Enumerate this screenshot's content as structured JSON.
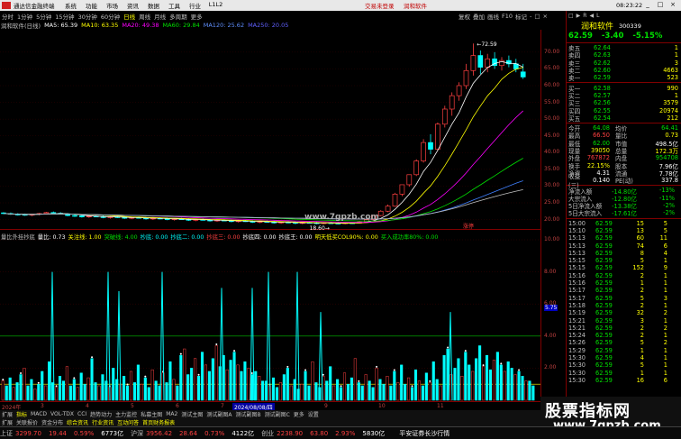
{
  "titlebar": {
    "app_title": "通达信金融终端",
    "menu": [
      "系统",
      "功能",
      "市场",
      "资讯",
      "数据",
      "工具",
      "行业",
      "L1L2"
    ],
    "warning": "交易未登录",
    "company": "润和软件",
    "clock": "08:23:22",
    "min": "_",
    "max": "□",
    "close": "×"
  },
  "periodbar": {
    "items": [
      "分时",
      "1分钟",
      "5分钟",
      "15分钟",
      "30分钟",
      "60分钟",
      "日线",
      "周线",
      "月线",
      "多周期",
      "更多"
    ],
    "active": "日线",
    "right_tools": [
      "复权",
      "叠加",
      "画线",
      "F10",
      "标记",
      "-",
      "□",
      "×"
    ]
  },
  "main_header": {
    "title": "润和软件(日线)",
    "ma5": "MA5: 65.39",
    "ma10": "MA10: 63.35",
    "ma20": "MA20: 49.38",
    "ma60": "MA60: 29.84",
    "ma120": "MA120: 25.62",
    "ma250": "MA250: 20.05"
  },
  "sub_header": {
    "items": [
      {
        "text": "量比外挂抄底",
        "color": "#c0c0c0"
      },
      {
        "text": "量比: 0.73",
        "color": "#ffffff"
      },
      {
        "text": "关注线: 1.00",
        "color": "#ffff00"
      },
      {
        "text": "突破线: 4.00",
        "color": "#00e000"
      },
      {
        "text": "抄底: 0.00",
        "color": "#00ffff"
      },
      {
        "text": "抄底二: 0.00",
        "color": "#00ffff"
      },
      {
        "text": "抄底三: 0.00",
        "color": "#ff4040"
      },
      {
        "text": "抄底四: 0.00",
        "color": "#ffffff"
      },
      {
        "text": "抄底王: 0.00",
        "color": "#ffffff"
      },
      {
        "text": "明天低买COL90%: 0.00",
        "color": "#ffff00"
      },
      {
        "text": "买入成功率80%: 0.00",
        "color": "#00e000"
      }
    ]
  },
  "y_axis": {
    "main": [
      "70.00",
      "65.00",
      "60.00",
      "55.00",
      "50.00",
      "45.00",
      "40.00",
      "35.00",
      "30.00",
      "25.00",
      "20.00"
    ],
    "sub": [
      "10.00",
      "8.00",
      "6.00",
      "5.75",
      "4.00",
      "2.00",
      "0.00"
    ],
    "current_marker": "5.75"
  },
  "chart_labels": {
    "high_label": "72.59",
    "low_label": "18.60",
    "watermark": "www.7gpzb.com",
    "zt_tag": "涨停"
  },
  "time_axis": [
    "2024年",
    "3",
    "4",
    "5",
    "6",
    "7",
    "8",
    "9",
    "10",
    "11"
  ],
  "time_axis_highlight": "2024/08/08/四",
  "bottom_tabs": [
    "扩展",
    "指标",
    "MACD",
    "VOL-TDX",
    "CCI",
    "趋势动力",
    "主力监控",
    "私募主图",
    "MA2",
    "测试主图",
    "测试副图A",
    "测试副图B",
    "测试副图C",
    "更多",
    "设置"
  ],
  "bottom_tabs2": [
    "扩展",
    "关联报价",
    "资金分布",
    "综合资讯",
    "行业资讯",
    "互动问答",
    "首页财务报表"
  ],
  "status": {
    "items": [
      {
        "label": "上证",
        "value": "3299.70",
        "chg": "19.44",
        "pct": "0.59%",
        "amt": "6773亿",
        "dir": "up"
      },
      {
        "label": "沪深",
        "value": "3956.42",
        "chg": "28.64",
        "pct": "0.73%",
        "amt": "4122亿",
        "dir": "up"
      },
      {
        "label": "创业",
        "value": "2238.90",
        "chg": "63.80",
        "pct": "2.93%",
        "amt": "5830亿",
        "dir": "up"
      }
    ],
    "right_text": "平安证券长沙行情"
  },
  "quote": {
    "top_tabs": [
      "□",
      "▶",
      "R",
      "◀",
      "L"
    ],
    "name": "润和软件",
    "code": "300339",
    "price": "62.59",
    "change": "-3.40",
    "pct": "-5.15%",
    "asks": [
      {
        "label": "卖五",
        "price": "62.64",
        "vol": "1"
      },
      {
        "label": "卖四",
        "price": "62.63",
        "vol": "1"
      },
      {
        "label": "卖三",
        "price": "62.62",
        "vol": "3"
      },
      {
        "label": "卖二",
        "price": "62.60",
        "vol": "4663"
      },
      {
        "label": "卖一",
        "price": "62.59",
        "vol": "523"
      }
    ],
    "bids": [
      {
        "label": "买一",
        "price": "62.58",
        "vol": "990"
      },
      {
        "label": "买二",
        "price": "62.57",
        "vol": "1"
      },
      {
        "label": "买三",
        "price": "62.56",
        "vol": "3579"
      },
      {
        "label": "买四",
        "price": "62.55",
        "vol": "20974"
      },
      {
        "label": "买五",
        "price": "62.54",
        "vol": "212"
      }
    ],
    "stats": [
      {
        "k1": "今开",
        "v1": "64.08",
        "c1": "green",
        "k2": "均价",
        "v2": "64.41",
        "c2": "green"
      },
      {
        "k1": "最高",
        "v1": "66.50",
        "c1": "red",
        "k2": "量比",
        "v2": "0.73",
        "c2": "yellow"
      },
      {
        "k1": "最低",
        "v1": "62.00",
        "c1": "green",
        "k2": "市值",
        "v2": "498.5亿",
        "c2": "white"
      },
      {
        "k1": "现量",
        "v1": "39050",
        "c1": "yellow",
        "k2": "总量",
        "v2": "172.3万",
        "c2": "yellow"
      },
      {
        "k1": "外盘",
        "v1": "767872",
        "c1": "red",
        "k2": "内盘",
        "v2": "954708",
        "c2": "green"
      },
      {
        "k1": "换手",
        "v1": "22.15%",
        "c1": "yellow",
        "k2": "股本",
        "v2": "7.96亿",
        "c2": "white"
      },
      {
        "k1": "净资",
        "v1": "4.31",
        "c1": "white",
        "k2": "流通",
        "v2": "7.78亿",
        "c2": "white"
      },
      {
        "k1": "收益(三)",
        "v1": "0.140",
        "c1": "white",
        "k2": "PE(动)",
        "v2": "337.8",
        "c2": "white"
      }
    ],
    "flows": [
      {
        "k": "净流入额",
        "v": "-14.80亿",
        "p": "-13%"
      },
      {
        "k": "大宗流入",
        "v": "-12.80亿",
        "p": "-11%"
      },
      {
        "k": "5日净流入额",
        "v": "-13.38亿",
        "p": "-2%"
      },
      {
        "k": "5日大宗流入",
        "v": "-17.61亿",
        "p": "-2%"
      }
    ],
    "ticks": [
      {
        "t": "15:00",
        "p": "62.59",
        "v": "15",
        "f": "5"
      },
      {
        "t": "15:10",
        "p": "62.59",
        "v": "13",
        "f": "5"
      },
      {
        "t": "15:13",
        "p": "62.59",
        "v": "60",
        "f": "11"
      },
      {
        "t": "15:13",
        "p": "62.59",
        "v": "74",
        "f": "6"
      },
      {
        "t": "15:13",
        "p": "62.59",
        "v": "8",
        "f": "4"
      },
      {
        "t": "15:15",
        "p": "62.59",
        "v": "5",
        "f": "1"
      },
      {
        "t": "15:15",
        "p": "62.59",
        "v": "152",
        "f": "9"
      },
      {
        "t": "15:16",
        "p": "62.59",
        "v": "2",
        "f": "1"
      },
      {
        "t": "15:16",
        "p": "62.59",
        "v": "1",
        "f": "1"
      },
      {
        "t": "15:17",
        "p": "62.59",
        "v": "2",
        "f": "1"
      },
      {
        "t": "15:17",
        "p": "62.59",
        "v": "5",
        "f": "3"
      },
      {
        "t": "15:18",
        "p": "62.59",
        "v": "2",
        "f": "1"
      },
      {
        "t": "15:19",
        "p": "62.59",
        "v": "32",
        "f": "2"
      },
      {
        "t": "15:21",
        "p": "62.59",
        "v": "3",
        "f": "1"
      },
      {
        "t": "15:21",
        "p": "62.59",
        "v": "2",
        "f": "2"
      },
      {
        "t": "15:24",
        "p": "62.59",
        "v": "2",
        "f": "1"
      },
      {
        "t": "15:26",
        "p": "62.59",
        "v": "5",
        "f": "2"
      },
      {
        "t": "15:29",
        "p": "62.59",
        "v": "1",
        "f": "1"
      },
      {
        "t": "15:30",
        "p": "62.59",
        "v": "4",
        "f": "1"
      },
      {
        "t": "15:30",
        "p": "62.59",
        "v": "5",
        "f": "1"
      },
      {
        "t": "15:30",
        "p": "62.59",
        "v": "1",
        "f": "1"
      },
      {
        "t": "15:30",
        "p": "62.59",
        "v": "16",
        "f": "6"
      }
    ]
  },
  "ad": {
    "line1": "股票指标网",
    "line2": "www.7gpzb.com"
  },
  "chart_data": {
    "type": "candlestick+histogram",
    "ylim_main": [
      18,
      74
    ],
    "ylim_sub": [
      0,
      10
    ],
    "candles": [
      [
        22.0,
        22.2,
        21.6,
        21.8
      ],
      [
        21.8,
        22.1,
        21.4,
        21.6
      ],
      [
        21.6,
        21.9,
        21.2,
        21.5
      ],
      [
        21.5,
        21.8,
        21.1,
        21.3
      ],
      [
        21.3,
        21.7,
        21.0,
        21.6
      ],
      [
        21.6,
        22.0,
        21.3,
        21.8
      ],
      [
        21.8,
        22.3,
        21.6,
        22.1
      ],
      [
        22.1,
        22.4,
        21.7,
        21.9
      ],
      [
        21.9,
        22.2,
        21.5,
        21.7
      ],
      [
        21.7,
        21.9,
        21.0,
        21.2
      ],
      [
        21.2,
        21.5,
        20.8,
        21.1
      ],
      [
        21.1,
        21.4,
        20.6,
        20.8
      ],
      [
        20.8,
        21.2,
        20.5,
        21.0
      ],
      [
        21.0,
        21.3,
        20.7,
        20.9
      ],
      [
        20.9,
        21.2,
        20.4,
        20.6
      ],
      [
        20.6,
        21.0,
        20.3,
        20.8
      ],
      [
        20.8,
        21.1,
        20.5,
        20.7
      ],
      [
        20.7,
        21.0,
        20.2,
        20.4
      ],
      [
        20.4,
        20.8,
        20.1,
        20.6
      ],
      [
        20.6,
        20.9,
        20.3,
        20.5
      ],
      [
        20.5,
        20.8,
        20.0,
        20.2
      ],
      [
        20.2,
        20.6,
        19.9,
        20.4
      ],
      [
        20.4,
        20.7,
        20.1,
        20.3
      ],
      [
        20.3,
        20.6,
        19.8,
        20.0
      ],
      [
        20.0,
        20.4,
        19.7,
        20.2
      ],
      [
        20.2,
        20.5,
        19.9,
        20.1
      ],
      [
        20.1,
        20.4,
        19.6,
        19.8
      ],
      [
        19.8,
        20.2,
        19.5,
        20.0
      ],
      [
        20.0,
        20.3,
        19.7,
        19.9
      ],
      [
        19.9,
        20.2,
        19.4,
        19.6
      ],
      [
        19.6,
        20.0,
        19.3,
        19.8
      ],
      [
        19.8,
        20.1,
        19.5,
        19.7
      ],
      [
        19.7,
        20.0,
        19.2,
        19.4
      ],
      [
        19.4,
        19.8,
        19.1,
        19.6
      ],
      [
        19.6,
        19.9,
        19.3,
        19.5
      ],
      [
        19.5,
        19.8,
        19.0,
        19.2
      ],
      [
        19.2,
        19.6,
        18.9,
        19.4
      ],
      [
        19.4,
        19.7,
        19.1,
        19.3
      ],
      [
        19.3,
        19.6,
        18.8,
        19.0
      ],
      [
        19.0,
        19.4,
        18.7,
        19.2
      ],
      [
        19.2,
        19.5,
        18.9,
        19.1
      ],
      [
        19.1,
        19.4,
        18.6,
        18.9
      ],
      [
        18.9,
        19.3,
        18.6,
        19.1
      ],
      [
        19.1,
        19.4,
        18.8,
        19.0
      ],
      [
        19.0,
        19.3,
        18.6,
        18.8
      ],
      [
        18.8,
        19.2,
        18.6,
        19.0
      ],
      [
        19.0,
        19.3,
        18.7,
        18.9
      ],
      [
        18.9,
        19.2,
        18.6,
        18.8
      ],
      [
        18.8,
        19.1,
        18.6,
        19.0
      ],
      [
        19.0,
        19.2,
        18.7,
        18.9
      ],
      [
        18.9,
        19.5,
        18.8,
        19.3
      ],
      [
        19.3,
        20.2,
        19.1,
        20.0
      ],
      [
        20.0,
        21.5,
        19.8,
        21.2
      ],
      [
        21.2,
        22.8,
        21.0,
        22.5
      ],
      [
        22.5,
        24.5,
        22.2,
        24.0
      ],
      [
        24.0,
        28.0,
        23.8,
        27.6
      ],
      [
        27.6,
        30.4,
        27.0,
        30.4
      ],
      [
        30.4,
        33.4,
        29.8,
        33.4
      ],
      [
        33.4,
        38.0,
        33.0,
        37.5
      ],
      [
        37.5,
        44.0,
        37.0,
        43.0
      ],
      [
        43.0,
        45.5,
        39.5,
        41.0
      ],
      [
        41.0,
        49.0,
        40.5,
        48.5
      ],
      [
        48.5,
        54.0,
        47.5,
        53.0
      ],
      [
        53.0,
        58.0,
        51.0,
        57.0
      ],
      [
        57.0,
        61.0,
        55.5,
        60.0
      ],
      [
        60.0,
        66.5,
        59.0,
        64.5
      ],
      [
        64.5,
        72.6,
        63.0,
        69.0
      ],
      [
        69.0,
        70.5,
        63.5,
        65.5
      ],
      [
        65.5,
        69.5,
        64.0,
        68.0
      ],
      [
        68.0,
        70.0,
        65.0,
        66.0
      ],
      [
        66.0,
        68.5,
        64.5,
        67.5
      ],
      [
        67.5,
        69.0,
        65.5,
        66.5
      ],
      [
        66.5,
        68.0,
        64.0,
        65.0
      ],
      [
        64.1,
        66.5,
        62.0,
        62.6
      ]
    ],
    "volume": [
      1.2,
      0.9,
      1.4,
      0.8,
      1.1,
      1.6,
      2.0,
      0.9,
      1.3,
      0.7,
      1.0,
      1.8,
      0.9,
      2.4,
      1.1,
      0.8,
      1.5,
      1.2,
      2.1,
      0.9,
      1.3,
      0.8,
      1.7,
      1.0,
      1.4,
      2.6,
      1.1,
      0.9,
      1.6,
      1.2,
      0.8,
      2.0,
      1.3,
      1.0,
      1.5,
      0.9,
      1.8,
      1.1,
      2.2,
      1.0,
      1.4,
      0.8,
      1.9,
      1.2,
      0.9,
      1.7,
      1.1,
      2.4,
      1.3,
      0.9,
      2.8,
      3.2,
      1.6,
      2.0,
      2.6,
      1.5,
      3.0,
      2.2,
      1.8,
      2.6,
      3.4,
      2.1,
      2.8,
      1.9,
      2.5,
      3.0,
      2.2,
      1.8,
      2.4,
      2.0,
      1.6,
      1.8,
      1.5,
      1.2
    ],
    "spikes": [
      [
        58,
        8.0
      ],
      [
        120,
        8.0
      ],
      [
        132,
        6.8
      ],
      [
        180,
        8.0
      ],
      [
        246,
        7.0
      ],
      [
        280,
        7.0
      ],
      [
        298,
        8.0
      ],
      [
        330,
        8.0
      ],
      [
        356,
        5.5
      ],
      [
        500,
        5.5
      ]
    ],
    "ma_colors": {
      "ma5": "#ffffff",
      "ma10": "#ffff00",
      "ma20": "#ff00ff",
      "ma60": "#00e000",
      "ma120": "#4080ff",
      "ma250": "#c0c0c0"
    }
  }
}
